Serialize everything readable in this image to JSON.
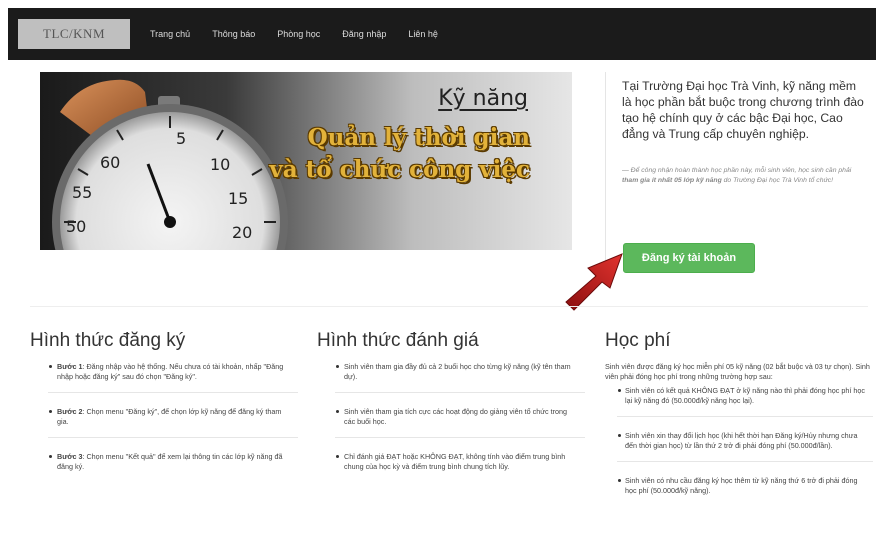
{
  "navbar": {
    "brand": "TLC/KNM",
    "links": [
      "Trang chủ",
      "Thông báo",
      "Phòng học",
      "Đăng nhập",
      "Liên hệ"
    ]
  },
  "hero": {
    "title": "Kỹ năng",
    "line1": "Quản lý thời gian",
    "line2": "và tổ chức công việc",
    "dial_numbers": [
      "5",
      "10",
      "15",
      "20",
      "50",
      "55",
      "60"
    ]
  },
  "side": {
    "text": "Tại Trường Đại học Trà Vinh, kỹ năng mềm là học phần bắt buộc trong chương trình đào tạo hệ chính quy ở các bậc Đại học, Cao đẳng và Trung cấp chuyên nghiệp.",
    "quote_prefix": "— Để công nhận hoàn thành học phần này, mỗi sinh viên, học sinh cần phải ",
    "quote_bold": "tham gia ít nhất 05 lớp kỹ năng",
    "quote_suffix": " do Trường Đại học Trà Vinh tổ chức!",
    "register_button": "Đăng ký tài khoản",
    "button_color": "#5cb85c"
  },
  "sections": {
    "registration": {
      "title": "Hình thức đăng ký",
      "items": [
        {
          "bold": "Bước 1",
          "text": ": Đăng nhập vào hệ thống. Nếu chưa có tài khoản, nhấp \"Đăng nhập hoặc đăng ký\" sau đó chọn \"Đăng ký\"."
        },
        {
          "bold": "Bước 2",
          "text": ": Chọn menu \"Đăng ký\", để chọn lớp kỹ năng để đăng ký tham gia."
        },
        {
          "bold": "Bước 3",
          "text": ": Chọn menu \"Kết quả\" để xem lại thông tin các lớp kỹ năng đã đăng ký."
        }
      ]
    },
    "evaluation": {
      "title": "Hình thức đánh giá",
      "items": [
        "Sinh viên tham gia đầy đủ cả 2 buổi học cho từng kỹ năng (kỹ tên tham dự).",
        "Sinh viên tham gia tích cực các hoạt động do giảng viên tổ chức trong các buổi học.",
        "Chỉ đánh giá ĐẠT hoặc KHÔNG ĐẠT, không tính vào điểm trung bình chung của học kỳ và điểm trung bình chung tích lũy."
      ]
    },
    "fee": {
      "title": "Học phí",
      "intro": "Sinh viên được đăng ký học miễn phí 05 kỹ năng (02 bắt buộc và 03 tự chọn). Sinh viên phải đóng học phí trong những trường hợp sau:",
      "items": [
        "Sinh viên có kết quả KHÔNG ĐẠT ở kỹ năng nào thì phải đóng học phí học lại kỹ năng đó (50.000đ/kỹ năng học lại).",
        "Sinh viên xin thay đổi lịch học (khi hết thời hạn Đăng ký/Hủy nhưng chưa đến thời gian học) từ lần thứ 2 trở đi phải đóng phí (50.000đ/lần).",
        "Sinh viên có nhu cầu đăng ký học thêm từ kỹ năng thứ 6 trở đi phải đóng học phí (50.000đ/kỹ năng)."
      ]
    }
  }
}
